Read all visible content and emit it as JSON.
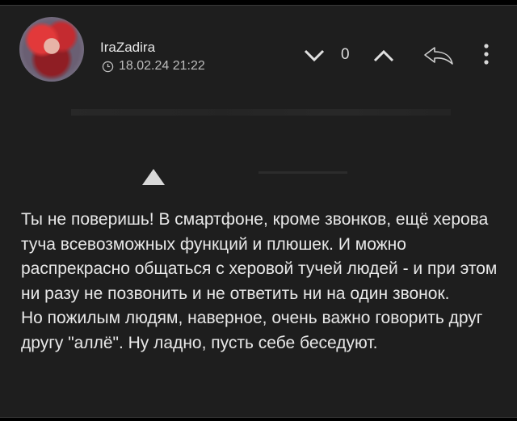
{
  "post": {
    "author": "IraZadira",
    "timestamp": "18.02.24 21:22",
    "score": "0",
    "text": "Ты не поверишь! В смартфоне, кроме звонков, ещё херова туча всевозможных функций и плюшек. И можно распрекрасно общаться с херовой тучей людей - и при этом ни разу не позвонить и не ответить ни на один звонок.\nНо пожилым людям, наверное, очень важно говорить друг другу \"аллё\". Ну ладно, пусть себе беседуют."
  },
  "icons": {
    "vote_down": "chevron-down-icon",
    "vote_up": "chevron-up-icon",
    "reply": "reply-arrow-icon",
    "more": "more-vertical-icon",
    "time": "clock-icon"
  },
  "colors": {
    "background": "#000000",
    "card": "#1e1e1e",
    "text": "#e8e8e8",
    "muted": "#bdbdbd"
  }
}
